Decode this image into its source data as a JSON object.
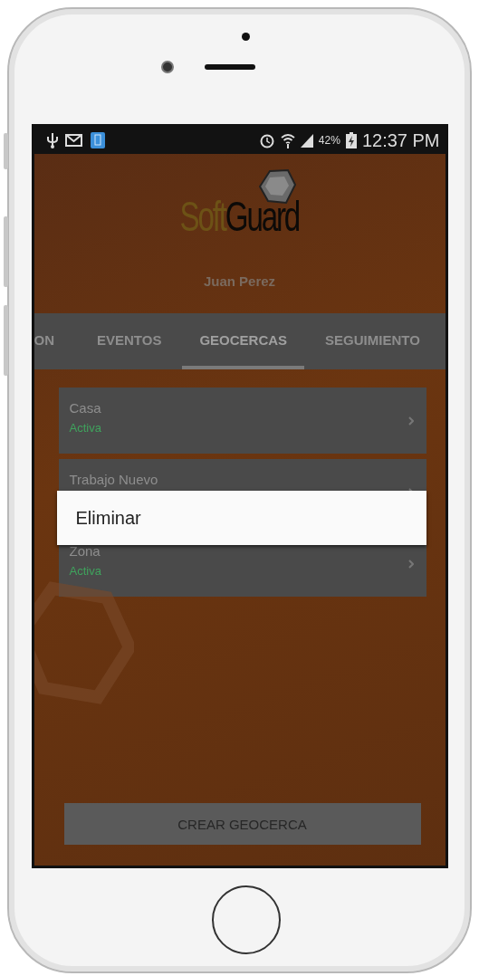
{
  "status_bar": {
    "battery": "42%",
    "time": "12:37 PM"
  },
  "header": {
    "logo": {
      "part1": "Soft",
      "part2": "Guard"
    },
    "user": "Juan Perez"
  },
  "tabs": [
    {
      "label": "ON",
      "selected": false
    },
    {
      "label": "EVENTOS",
      "selected": false
    },
    {
      "label": "GEOCERCAS",
      "selected": true
    },
    {
      "label": "SEGUIMIENTO",
      "selected": false
    }
  ],
  "geofences": [
    {
      "name": "Casa",
      "status": "Activa"
    },
    {
      "name": "Trabajo Nuevo"
    },
    {
      "name": "Zona",
      "status": "Activa"
    }
  ],
  "context_menu": {
    "items": [
      {
        "label": "Eliminar"
      }
    ]
  },
  "create_button": "CREAR GEOCERCA"
}
